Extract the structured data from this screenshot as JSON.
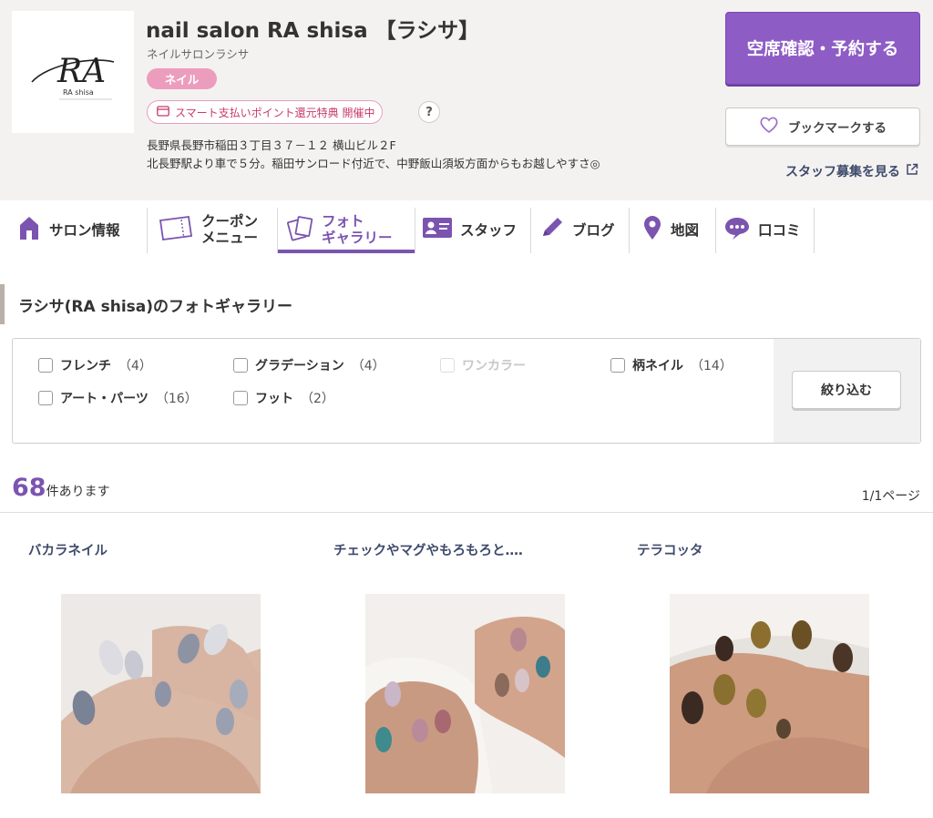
{
  "salon": {
    "name": "nail salon RA shisa 【ラシサ】",
    "kana": "ネイルサロンラシサ",
    "category": "ネイル",
    "payment_promo": "スマート支払いポイント還元特典 開催中",
    "help": "?",
    "address_line1": "長野県長野市稲田３丁目３７－１２ 横山ビル２F",
    "address_line2": "北長野駅より車で５分。稲田サンロード付近で、中野飯山須坂方面からもお越しやすさ◎",
    "logo_text": "RA",
    "logo_sub": "RA shisa"
  },
  "actions": {
    "reserve": "空席確認・予約する",
    "bookmark": "ブックマークする",
    "staff_recruit": "スタッフ募集を見る"
  },
  "nav": {
    "items": [
      {
        "label": "サロン情報",
        "icon": "house-icon"
      },
      {
        "label1": "クーポン",
        "label2": "メニュー",
        "icon": "coupon-icon"
      },
      {
        "label1": "フォト",
        "label2": "ギャラリー",
        "icon": "photo-icon",
        "active": true
      },
      {
        "label": "スタッフ",
        "icon": "staff-card-icon"
      },
      {
        "label": "ブログ",
        "icon": "pencil-icon"
      },
      {
        "label": "地図",
        "icon": "map-pin-icon"
      },
      {
        "label": "口コミ",
        "icon": "speech-bubble-icon"
      }
    ],
    "accent_color": "#7b54b0"
  },
  "gallery": {
    "title": "ラシサ(RA shisa)のフォトギャラリー",
    "filters": [
      {
        "label": "フレンチ",
        "count": "（4）",
        "enabled": true
      },
      {
        "label": "グラデーション",
        "count": "（4）",
        "enabled": true
      },
      {
        "label": "ワンカラー",
        "count": "",
        "enabled": false
      },
      {
        "label": "柄ネイル",
        "count": "（14）",
        "enabled": true
      },
      {
        "label": "アート・パーツ",
        "count": "（16）",
        "enabled": true
      },
      {
        "label": "フット",
        "count": "（2）",
        "enabled": true
      }
    ],
    "filter_button": "絞り込む",
    "result_count": "68",
    "result_suffix": "件あります",
    "page_info": "1/1ページ",
    "photos": [
      {
        "title": "バカラネイル"
      },
      {
        "title": "チェックやマグやもろもろと‥‥"
      },
      {
        "title": "テラコッタ"
      }
    ]
  }
}
